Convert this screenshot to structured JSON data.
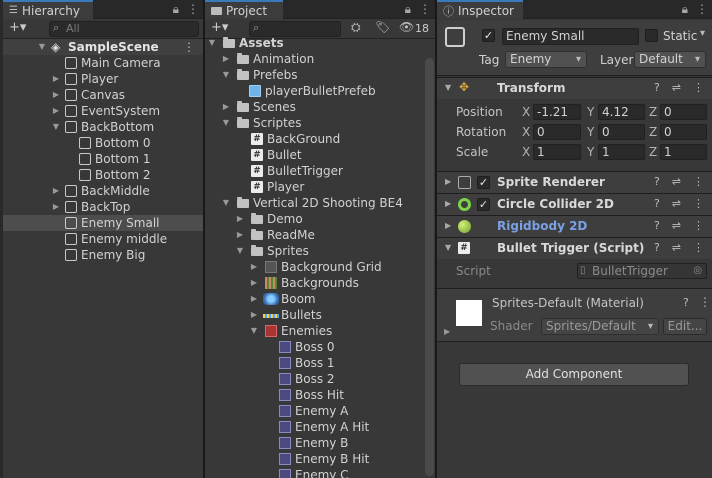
{
  "hierarchy": {
    "tab_label": "Hierarchy",
    "add_label": "+▾",
    "search_placeholder": "All",
    "scene": "SampleScene",
    "items": [
      {
        "label": "Main Camera"
      },
      {
        "label": "Player"
      },
      {
        "label": "Canvas"
      },
      {
        "label": "EventSystem"
      },
      {
        "label": "BackBottom"
      },
      {
        "label": "Bottom 0"
      },
      {
        "label": "Bottom 1"
      },
      {
        "label": "Bottom 2"
      },
      {
        "label": "BackMiddle"
      },
      {
        "label": "BackTop"
      },
      {
        "label": "Enemy Small"
      },
      {
        "label": "Enemy middle"
      },
      {
        "label": "Enemy Big"
      }
    ]
  },
  "project": {
    "tab_label": "Project",
    "add_label": "+▾",
    "hidden_count": "18",
    "items": [
      {
        "label": "Assets"
      },
      {
        "label": "Animation"
      },
      {
        "label": "Prefebs"
      },
      {
        "label": "playerBulletPrefeb"
      },
      {
        "label": "Scenes"
      },
      {
        "label": "Scriptes"
      },
      {
        "label": "BackGround"
      },
      {
        "label": "Bullet"
      },
      {
        "label": "BulletTrigger"
      },
      {
        "label": "Player"
      },
      {
        "label": "Vertical 2D Shooting BE4"
      },
      {
        "label": "Demo"
      },
      {
        "label": "ReadMe"
      },
      {
        "label": "Sprites"
      },
      {
        "label": "Background Grid"
      },
      {
        "label": "Backgrounds"
      },
      {
        "label": "Boom"
      },
      {
        "label": "Bullets"
      },
      {
        "label": "Enemies"
      },
      {
        "label": "Boss 0"
      },
      {
        "label": "Boss 1"
      },
      {
        "label": "Boss 2"
      },
      {
        "label": "Boss Hit"
      },
      {
        "label": "Enemy A"
      },
      {
        "label": "Enemy A Hit"
      },
      {
        "label": "Enemy B"
      },
      {
        "label": "Enemy B Hit"
      },
      {
        "label": "Enemy C"
      }
    ]
  },
  "inspector": {
    "tab_label": "Inspector",
    "object_name": "Enemy Small",
    "static_label": "Static",
    "tag_label": "Tag",
    "tag_value": "Enemy",
    "layer_label": "Layer",
    "layer_value": "Default",
    "transform": {
      "title": "Transform",
      "position_label": "Position",
      "rotation_label": "Rotation",
      "scale_label": "Scale",
      "x": "X",
      "y": "Y",
      "z": "Z",
      "position": [
        "-1.21",
        "4.12",
        "0"
      ],
      "rotation": [
        "0",
        "0",
        "0"
      ],
      "scale": [
        "1",
        "1",
        "1"
      ]
    },
    "components": [
      {
        "title": "Sprite Renderer"
      },
      {
        "title": "Circle Collider 2D"
      },
      {
        "title": "Rigidbody 2D"
      },
      {
        "title": "Bullet Trigger (Script)"
      }
    ],
    "script_label": "Script",
    "script_value": "BulletTrigger",
    "material_title": "Sprites-Default (Material)",
    "shader_label": "Shader",
    "shader_value": "Sprites/Default",
    "edit_label": "Edit...",
    "add_component_label": "Add Component",
    "rigidbody_color": "#7ba0e4",
    "accent_color": "#3a79bb"
  }
}
